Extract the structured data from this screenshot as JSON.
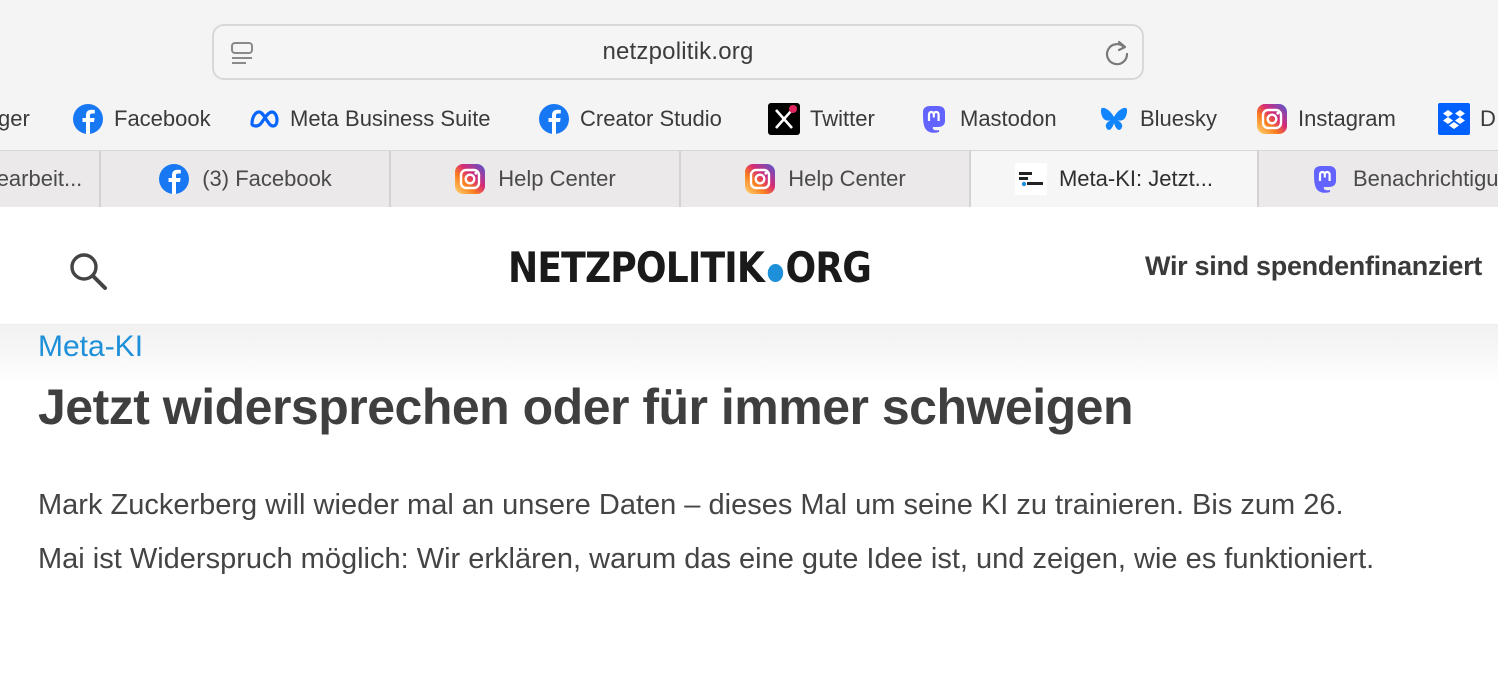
{
  "browser": {
    "url": "netzpolitik.org"
  },
  "bookmarks": [
    {
      "label": "ger",
      "icon": "none"
    },
    {
      "label": "Facebook",
      "icon": "facebook-icon"
    },
    {
      "label": "Meta Business Suite",
      "icon": "meta-icon"
    },
    {
      "label": "Creator Studio",
      "icon": "facebook-icon"
    },
    {
      "label": "Twitter",
      "icon": "x-icon"
    },
    {
      "label": "Mastodon",
      "icon": "mastodon-icon"
    },
    {
      "label": "Bluesky",
      "icon": "bluesky-icon"
    },
    {
      "label": "Instagram",
      "icon": "instagram-icon"
    },
    {
      "label": "D",
      "icon": "dropbox-icon"
    }
  ],
  "tabs": [
    {
      "label": "earbeit...",
      "icon": "none"
    },
    {
      "label": "(3) Facebook",
      "icon": "facebook-icon"
    },
    {
      "label": "Help Center",
      "icon": "instagram-icon"
    },
    {
      "label": "Help Center",
      "icon": "instagram-icon"
    },
    {
      "label": "Meta-KI: Jetzt...",
      "icon": "netzpolitik-favicon",
      "active": true
    },
    {
      "label": "Benachrichtigu",
      "icon": "mastodon-icon"
    }
  ],
  "site": {
    "logo_left": "NETZPOLITIK",
    "logo_right": "ORG",
    "donate": "Wir sind spendenfinanziert",
    "accent": "#1e8fd9"
  },
  "article": {
    "kicker": "Meta-KI",
    "headline": "Jetzt widersprechen oder für immer schweigen",
    "lead": "Mark Zuckerberg will wieder mal an unsere Daten – dieses Mal um seine KI zu trainieren. Bis zum 26. Mai ist Widerspruch möglich: Wir erklären, warum das eine gute Idee ist, und zeigen, wie es funktioniert."
  }
}
